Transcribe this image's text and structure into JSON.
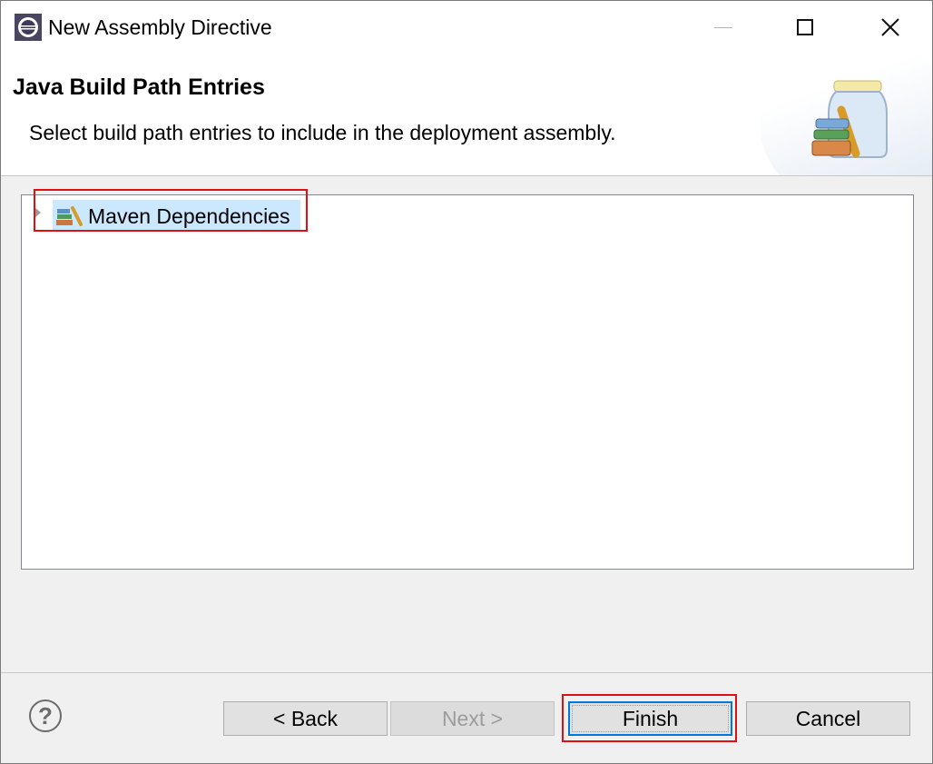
{
  "window": {
    "title": "New Assembly Directive",
    "controls": {
      "minimize": "minimize-icon",
      "maximize": "maximize-icon",
      "close": "close-icon"
    }
  },
  "header": {
    "title": "Java Build Path Entries",
    "description": "Select build path entries to include in the deployment assembly."
  },
  "tree": {
    "items": [
      {
        "label": "Maven Dependencies",
        "icon": "library-icon",
        "selected": true,
        "expandable": true
      }
    ]
  },
  "footer": {
    "help_icon": "help-icon",
    "back_label": "< Back",
    "next_label": "Next >",
    "finish_label": "Finish",
    "cancel_label": "Cancel"
  },
  "colors": {
    "highlight": "#e01010",
    "selection": "#cce8ff",
    "focus": "#0078d7"
  }
}
